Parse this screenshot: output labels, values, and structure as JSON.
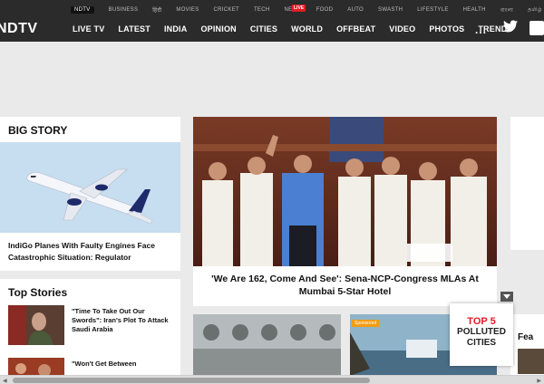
{
  "header": {
    "logo": "NDTV",
    "subnav": [
      "NDTV",
      "BUSINESS",
      "हिंदी",
      "MOVIES",
      "CRICKET",
      "TECH",
      "NEWS",
      "FOOD",
      "AUTO",
      "SWASTH",
      "LIFESTYLE",
      "HEALTH",
      "বাংলা",
      "தமிழ்"
    ],
    "live_badge": "LIVE",
    "mainnav": [
      "LIVE TV",
      "LATEST",
      "INDIA",
      "OPINION",
      "CITIES",
      "WORLD",
      "OFFBEAT",
      "VIDEO",
      "PHOTOS",
      "TRENDS"
    ],
    "more": "..."
  },
  "big_story": {
    "title": "BIG STORY",
    "headline": "IndiGo Planes With Faulty Engines Face Catastrophic Situation: Regulator"
  },
  "top_stories": {
    "title": "Top Stories",
    "items": [
      {
        "headline": "\"Time To Take Out Our Swords\": Iran's Plot To Attack Saudi Arabia"
      },
      {
        "headline": "\"Won't Get Between"
      }
    ]
  },
  "main_story": {
    "headline": "'We Are 162, Come And See': Sena-NCP-Congress MLAs At Mumbai 5-Star Hotel"
  },
  "polluted_widget": {
    "line1": "TOP 5",
    "line2": "POLLUTED",
    "line3": "CITIES"
  },
  "tiles": {
    "tile2_badge": "Sponsored",
    "tile3_partial": "Fea"
  },
  "colors": {
    "header_bg": "#2b2b2b",
    "accent_red": "#e21b22",
    "page_bg": "#eaeaea"
  }
}
